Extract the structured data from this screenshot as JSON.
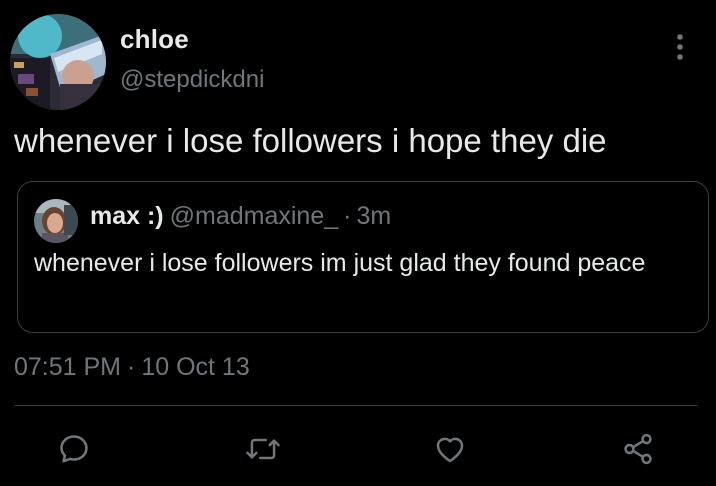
{
  "tweet": {
    "author": {
      "display_name": "chloe",
      "handle": "@stepdickdni",
      "avatar_icon": "avatar-image"
    },
    "text": "whenever i lose followers i hope they die",
    "more_icon": "more-options-icon",
    "quoted": {
      "display_name": "max :)",
      "handle": "@madmaxine_",
      "separator": "·",
      "time_ago": "3m",
      "text": "whenever i lose followers im just glad they found peace",
      "avatar_icon": "avatar-image"
    },
    "timestamp": {
      "time": "07:51 PM",
      "separator": "·",
      "date": "10 Oct 13"
    },
    "actions": [
      {
        "name": "reply",
        "icon": "reply-icon"
      },
      {
        "name": "retweet",
        "icon": "retweet-icon"
      },
      {
        "name": "like",
        "icon": "heart-icon"
      },
      {
        "name": "share",
        "icon": "share-icon"
      }
    ],
    "colors": {
      "background": "#000000",
      "primary_text": "#e7e9ea",
      "secondary_text": "#71767b",
      "border": "#3a3d42"
    }
  }
}
